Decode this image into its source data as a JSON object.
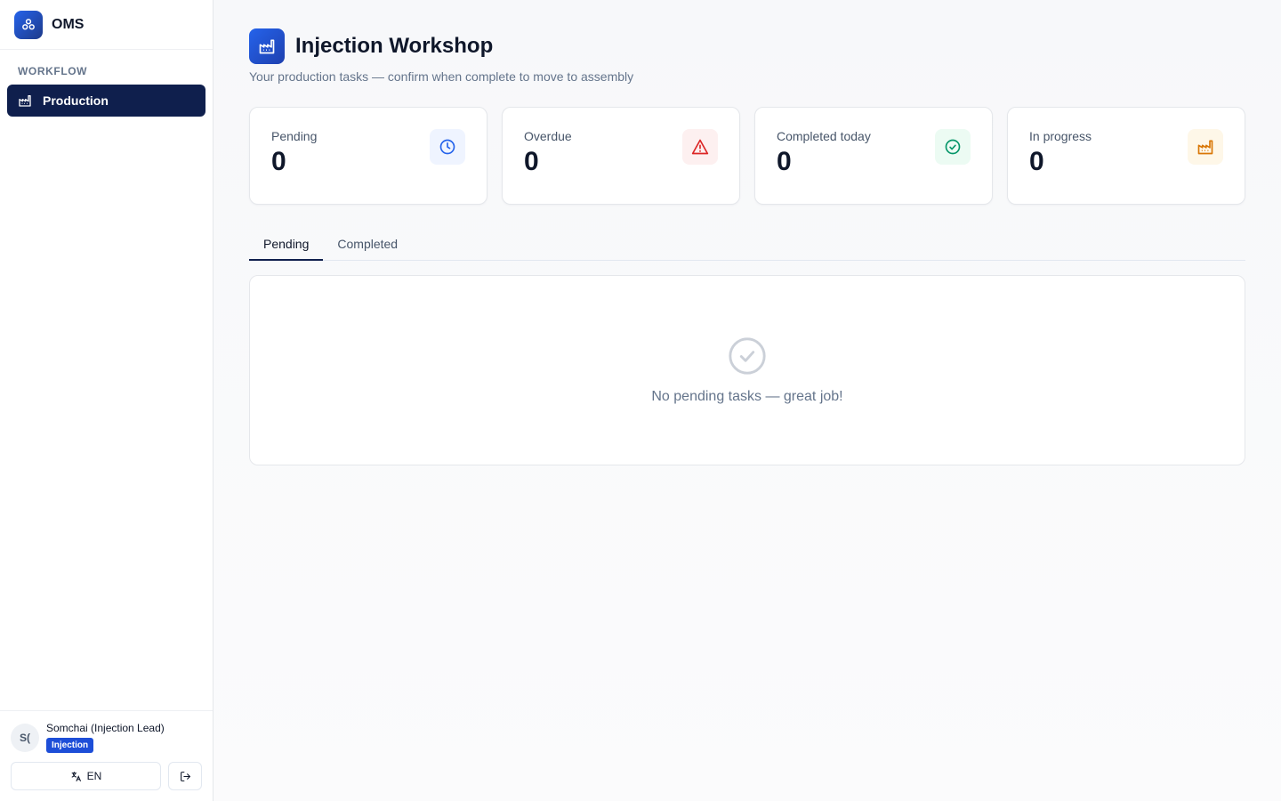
{
  "app": {
    "name": "OMS"
  },
  "sidebar": {
    "section_label": "WORKFLOW",
    "items": [
      {
        "label": "Production",
        "icon": "factory-icon",
        "active": true
      }
    ]
  },
  "user": {
    "initials": "S(",
    "name": "Somchai (Injection Lead)",
    "badge": "Injection",
    "language": "EN"
  },
  "header": {
    "title": "Injection Workshop",
    "subtitle": "Your production tasks — confirm when complete to move to assembly"
  },
  "stats": [
    {
      "label": "Pending",
      "value": "0",
      "icon": "clock-icon",
      "color": "#2563eb"
    },
    {
      "label": "Overdue",
      "value": "0",
      "icon": "alert-triangle-icon",
      "color": "#dc2626"
    },
    {
      "label": "Completed today",
      "value": "0",
      "icon": "check-circle-icon",
      "color": "#059669"
    },
    {
      "label": "In progress",
      "value": "0",
      "icon": "factory-icon",
      "color": "#d97706"
    }
  ],
  "tabs": [
    {
      "label": "Pending",
      "active": true
    },
    {
      "label": "Completed",
      "active": false
    }
  ],
  "empty_state": {
    "icon": "check-circle-icon",
    "message": "No pending tasks — great job!"
  }
}
